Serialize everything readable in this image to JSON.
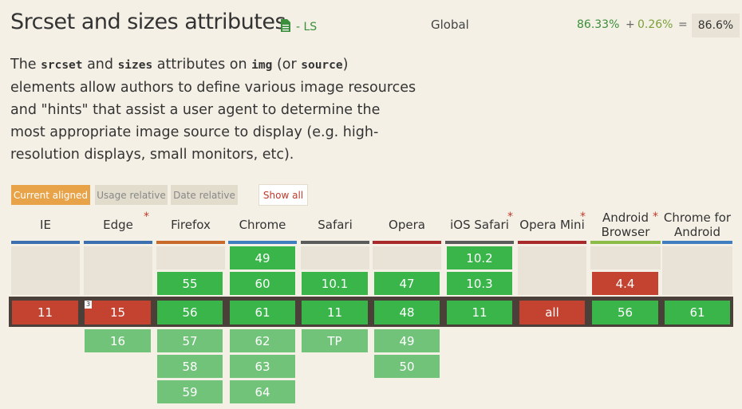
{
  "header": {
    "title": "Srcset and sizes attributes",
    "spec_status": "- LS",
    "usage_scope": "Global",
    "support_full": "86.33%",
    "plus": "+",
    "support_partial": "0.26%",
    "equals": "=",
    "support_total": "86.6%"
  },
  "description": {
    "p1": "The ",
    "code1": "srcset",
    "p2": " and ",
    "code2": "sizes",
    "p3": " attributes on ",
    "code3": "img",
    "p4": " (or ",
    "code4": "source",
    "p5": ") elements allow authors to define various image resources and \"hints\" that assist a user agent to determine the most appropriate image source to display (e.g. high-resolution displays, small monitors, etc)."
  },
  "view_buttons": {
    "current_aligned": "Current aligned",
    "usage_relative": "Usage relative",
    "date_relative": "Date relative",
    "show_all": "Show all"
  },
  "colors": {
    "supported": "#39b54a",
    "supported_future": "#72c37a",
    "unsupported": "#c44230",
    "accent": "#e8a248"
  },
  "browsers": [
    {
      "name": "IE",
      "bar": "#3b6fb0",
      "note": false
    },
    {
      "name": "Edge",
      "bar": "#3b6fb0",
      "note": true
    },
    {
      "name": "Firefox",
      "bar": "#c86a2a",
      "note": false
    },
    {
      "name": "Chrome",
      "bar": "#3f7fc0",
      "note": false
    },
    {
      "name": "Safari",
      "bar": "#5b5b5b",
      "note": false
    },
    {
      "name": "Opera",
      "bar": "#a82a2a",
      "note": false
    },
    {
      "name": "iOS Safari",
      "bar": "#5b5b5b",
      "note": true
    },
    {
      "name": "Opera Mini",
      "bar": "#a82a2a",
      "note": true
    },
    {
      "name": "Android Browser",
      "bar": "#8dbb47",
      "note": true
    },
    {
      "name": "Chrome for Android",
      "bar": "#3f7fc0",
      "note": false
    }
  ],
  "note_symbol": "*",
  "current_note_number": "3",
  "versions": {
    "ie": {
      "past2": "",
      "past1": "",
      "current": "11",
      "future1": "",
      "future2": "",
      "future3": ""
    },
    "edge": {
      "past2": "",
      "past1": "",
      "current": "15",
      "future1": "16",
      "future2": "",
      "future3": ""
    },
    "firefox": {
      "past2": "",
      "past1": "55",
      "current": "56",
      "future1": "57",
      "future2": "58",
      "future3": "59"
    },
    "chrome": {
      "past2": "49",
      "past1": "60",
      "current": "61",
      "future1": "62",
      "future2": "63",
      "future3": "64"
    },
    "safari": {
      "past2": "",
      "past1": "10.1",
      "current": "11",
      "future1": "TP",
      "future2": "",
      "future3": ""
    },
    "opera": {
      "past2": "",
      "past1": "47",
      "current": "48",
      "future1": "49",
      "future2": "50",
      "future3": ""
    },
    "ios_safari": {
      "past2": "10.2",
      "past1": "10.3",
      "current": "11",
      "future1": "",
      "future2": "",
      "future3": ""
    },
    "opera_mini": {
      "past2": "",
      "past1": "",
      "current": "all",
      "future1": "",
      "future2": "",
      "future3": ""
    },
    "android_browser": {
      "past2": "",
      "past1": "4.4",
      "current": "56",
      "future1": "",
      "future2": "",
      "future3": ""
    },
    "chrome_android": {
      "past2": "",
      "past1": "",
      "current": "61",
      "future1": "",
      "future2": "",
      "future3": ""
    }
  }
}
